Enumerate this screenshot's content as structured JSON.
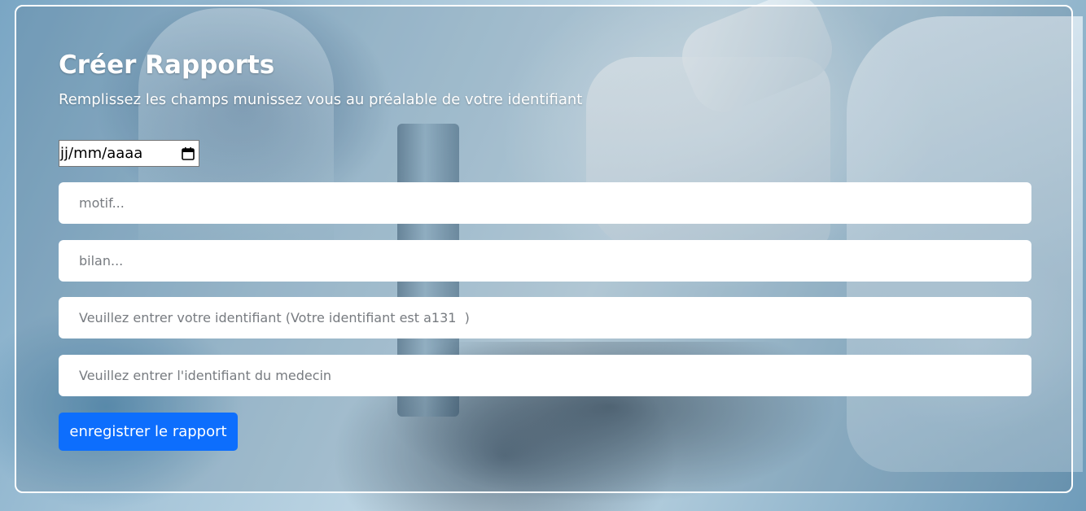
{
  "form": {
    "title": "Créer Rapports",
    "subtitle": "Remplissez les champs munissez vous au préalable de votre identifiant",
    "date_field": {
      "placeholder": "jj/mm/aaaa",
      "icon": "calendar-icon"
    },
    "fields": [
      {
        "placeholder": "motif..."
      },
      {
        "placeholder": "bilan..."
      },
      {
        "placeholder": "Veuillez entrer votre identifiant (Votre identifiant est a131  )"
      },
      {
        "placeholder": "Veuillez entrer l'identifiant du medecin"
      }
    ],
    "submit_label": "enregistrer le rapport"
  },
  "colors": {
    "primary_button": "#0d6efd",
    "card_border": "#ffffff"
  }
}
